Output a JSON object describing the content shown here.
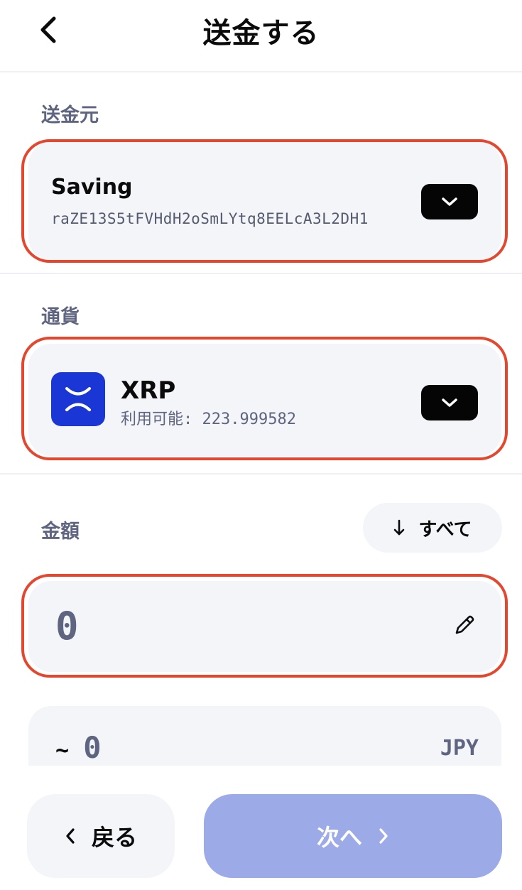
{
  "header": {
    "title": "送金する",
    "back_icon": "chevron-left-icon"
  },
  "source": {
    "label": "送金元",
    "account_name": "Saving",
    "account_address": "raZE13S5tFVHdH2oSmLYtq8EELcA3L2DH1",
    "dropdown_icon": "chevron-down-icon"
  },
  "currency": {
    "label": "通貨",
    "symbol": "XRP",
    "available_label": "利用可能:",
    "available_value": "223.999582",
    "logo_icon": "xrp-logo-icon",
    "dropdown_icon": "chevron-down-icon"
  },
  "amount": {
    "label": "金額",
    "all_button_label": "すべて",
    "all_button_icon": "arrow-down-icon",
    "value": "0",
    "edit_icon": "pencil-icon"
  },
  "fiat": {
    "approx_symbol": "~",
    "value": "0",
    "unit": "JPY"
  },
  "footer": {
    "back_label": "戻る",
    "next_label": "次へ",
    "back_icon": "chevron-left-icon",
    "next_icon": "chevron-right-icon"
  },
  "colors": {
    "highlight": "#e4472e",
    "card_bg": "#f3f5f9",
    "xrp_brand": "#1a36d4",
    "next_button_disabled": "#9caae8",
    "muted_text": "#5f6580"
  }
}
